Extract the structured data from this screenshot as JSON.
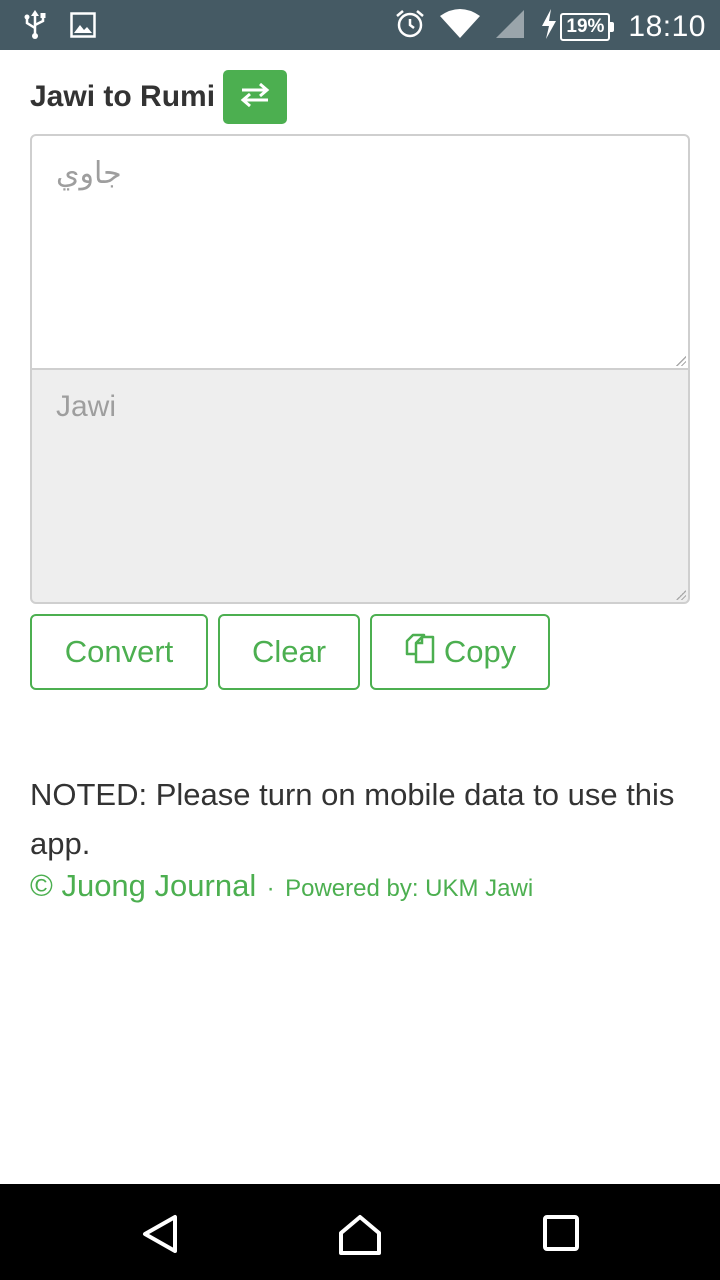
{
  "status_bar": {
    "time": "18:10",
    "battery": "19%",
    "left_icons": [
      "usb-icon",
      "image-icon"
    ],
    "right_icons": [
      "alarm-icon",
      "wifi-icon",
      "signal-icon",
      "charging-icon",
      "battery-icon"
    ]
  },
  "header": {
    "title": "Jawi to Rumi",
    "swap_icon": "swap-arrows-icon"
  },
  "input": {
    "placeholder": "جاوي"
  },
  "output": {
    "placeholder": "Jawi"
  },
  "buttons": {
    "convert": "Convert",
    "clear": "Clear",
    "copy": "Copy",
    "copy_icon": "copy-icon"
  },
  "note": "NOTED: Please turn on mobile data to use this app.",
  "footer": {
    "brand": "© Juong Journal",
    "separator": "·",
    "powered": "Powered by: UKM Jawi"
  },
  "colors": {
    "accent": "#4caf50",
    "status_bar": "#455a64",
    "nav_bar": "#000000",
    "output_bg": "#eeeeee"
  }
}
